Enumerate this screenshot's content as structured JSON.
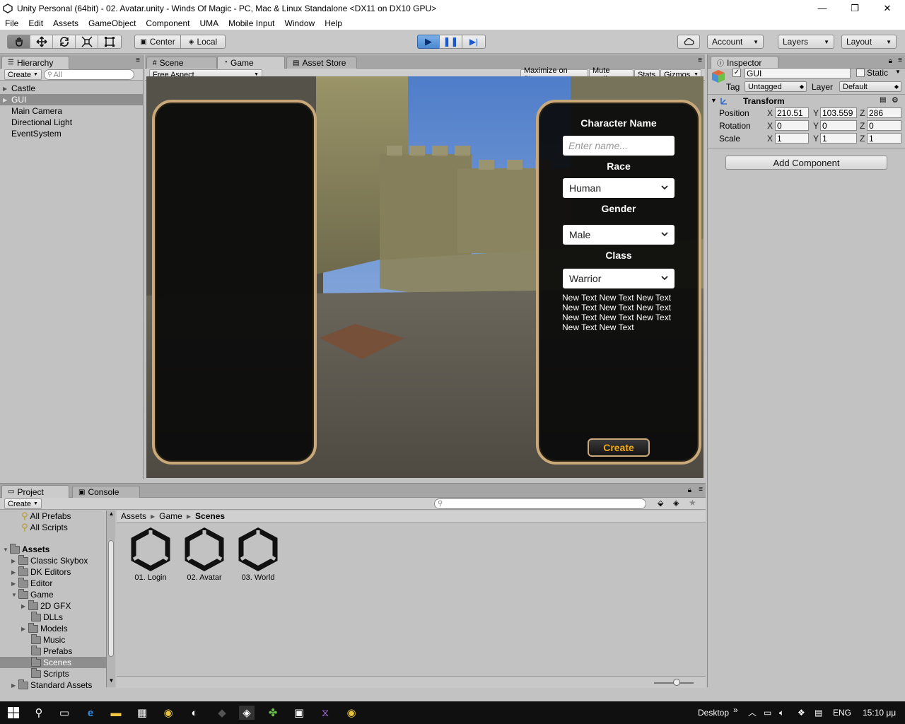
{
  "window": {
    "title": "Unity Personal (64bit) - 02. Avatar.unity - Winds Of Magic - PC, Mac & Linux Standalone <DX11 on DX10 GPU>",
    "minimize": "—",
    "maximize": "❐",
    "close": "✕"
  },
  "menu": [
    "File",
    "Edit",
    "Assets",
    "GameObject",
    "Component",
    "UMA",
    "Mobile Input",
    "Window",
    "Help"
  ],
  "toolbar": {
    "center": "Center",
    "local": "Local",
    "account": "Account",
    "layers": "Layers",
    "layout": "Layout"
  },
  "hierarchy": {
    "tab": "Hierarchy",
    "create": "Create",
    "search_placeholder": "All",
    "items": [
      "Castle",
      "GUI",
      "Main Camera",
      "Directional Light",
      "EventSystem"
    ]
  },
  "gameview": {
    "tabs": [
      "Scene",
      "Game",
      "Asset Store"
    ],
    "aspect": "Free Aspect",
    "options": [
      "Maximize on Play",
      "Mute audio",
      "Stats",
      "Gizmos"
    ]
  },
  "character_ui": {
    "name_label": "Character Name",
    "name_placeholder": "Enter name...",
    "race_label": "Race",
    "race_value": "Human",
    "gender_label": "Gender",
    "gender_value": "Male",
    "class_label": "Class",
    "class_value": "Warrior",
    "text_lines": [
      "New Text New Text New Text",
      "New Text New Text New Text",
      "New Text New Text New Text",
      "New Text New Text"
    ],
    "create_button": "Create"
  },
  "inspector": {
    "tab": "Inspector",
    "object_name": "GUI",
    "static_label": "Static",
    "tag_label": "Tag",
    "tag_value": "Untagged",
    "layer_label": "Layer",
    "layer_value": "Default",
    "transform_title": "Transform",
    "position_label": "Position",
    "rotation_label": "Rotation",
    "scale_label": "Scale",
    "position": {
      "x": "210.51",
      "y": "103.559",
      "z": "286"
    },
    "rotation": {
      "x": "0",
      "y": "0",
      "z": "0"
    },
    "scale": {
      "x": "1",
      "y": "1",
      "z": "1"
    },
    "axis_x": "X",
    "axis_y": "Y",
    "axis_z": "Z",
    "add_component": "Add Component"
  },
  "project": {
    "tabs": [
      "Project",
      "Console"
    ],
    "create": "Create",
    "favorites": [
      "All Prefabs",
      "All Scripts"
    ],
    "root": "Assets",
    "tree": [
      "Classic Skybox",
      "DK Editors",
      "Editor",
      "Game",
      "2D GFX",
      "DLLs",
      "Models",
      "Music",
      "Prefabs",
      "Scenes",
      "Scripts",
      "Standard Assets"
    ],
    "breadcrumb": [
      "Assets",
      "Game",
      "Scenes"
    ],
    "assets": [
      "01. Login",
      "02. Avatar",
      "03. World"
    ]
  },
  "taskbar": {
    "desktop": "Desktop",
    "chevron": "»",
    "lang": "ENG",
    "time": "15:10 μμ"
  },
  "colors": {
    "frame_border": "#c9a97a",
    "create_text": "#f0a818",
    "selection": "#8e8e8e"
  }
}
